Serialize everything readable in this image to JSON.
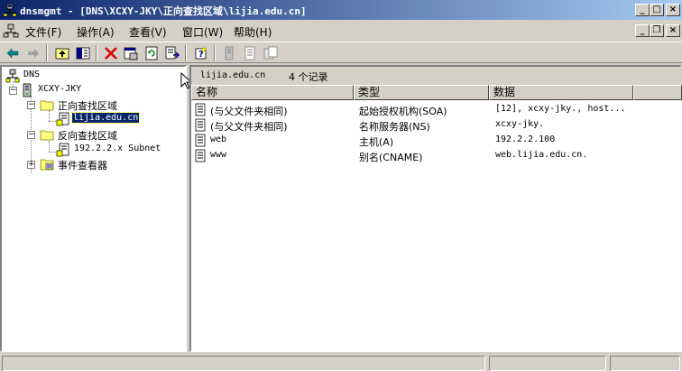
{
  "window": {
    "title": "dnsmgmt - [DNS\\XCXY-JKY\\正向查找区域\\lijia.edu.cn]",
    "controls": {
      "minimize": "_",
      "maximize": "□",
      "close": "×"
    }
  },
  "menubar": {
    "items": [
      {
        "label": "文件(F)"
      },
      {
        "label": "操作(A)"
      },
      {
        "label": "查看(V)"
      },
      {
        "label": "窗口(W)"
      },
      {
        "label": "帮助(H)"
      }
    ],
    "mdi_controls": {
      "minimize": "_",
      "restore": "❐",
      "close": "×"
    }
  },
  "toolbar": {
    "buttons": [
      "back-icon",
      "forward-icon",
      "up-folder-icon",
      "show-hide-tree-icon",
      "delete-icon",
      "properties-icon",
      "refresh-icon",
      "export-list-icon",
      "help-icon",
      "new-server-icon",
      "new-record-icon",
      "new-zone-icon"
    ]
  },
  "tree": {
    "root": "DNS",
    "server": "XCXY-JKY",
    "forward_zones": "正向查找区域",
    "forward_zone_item": "lijia.edu.cn",
    "reverse_zones": "反向查找区域",
    "reverse_zone_item": "192.2.2.x Subnet",
    "event_viewer": "事件查看器",
    "selected": "lijia.edu.cn"
  },
  "list": {
    "zone_name": "lijia.edu.cn",
    "record_count": "4 个记录",
    "columns": [
      "名称",
      "类型",
      "数据"
    ],
    "rows": [
      {
        "name": "(与父文件夹相同)",
        "type": "起始授权机构(SOA)",
        "data": "[12], xcxy-jky., host..."
      },
      {
        "name": "(与父文件夹相同)",
        "type": "名称服务器(NS)",
        "data": "xcxy-jky."
      },
      {
        "name": "web",
        "type": "主机(A)",
        "data": "192.2.2.100"
      },
      {
        "name": "www",
        "type": "别名(CNAME)",
        "data": "web.lijia.edu.cn."
      }
    ]
  },
  "colors": {
    "title_start": "#0a246a",
    "title_end": "#a6caf0",
    "face": "#d4d0c8",
    "selection": "#0a246a"
  }
}
